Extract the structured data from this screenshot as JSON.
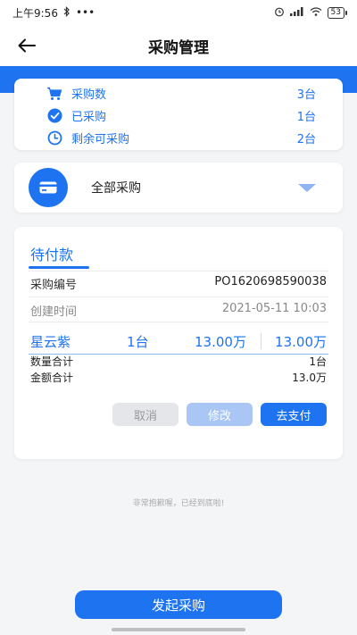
{
  "status_bar": {
    "time": "上午9:56",
    "battery": "53",
    "dots": "•••"
  },
  "header": {
    "title": "采购管理"
  },
  "summary": {
    "items": [
      {
        "label": "采购数",
        "value": "3台",
        "icon": "cart-icon"
      },
      {
        "label": "已采购",
        "value": "1台",
        "icon": "check-circle-icon"
      },
      {
        "label": "剩余可采购",
        "value": "2台",
        "icon": "clock-icon"
      }
    ]
  },
  "filter": {
    "selected": "全部采购",
    "icon": "card-icon"
  },
  "order": {
    "status": "待付款",
    "number_label": "采购编号",
    "number_value": "PO1620698590038",
    "created_label": "创建时间",
    "created_value": "2021-05-11 10:03",
    "product": {
      "name": "星云紫",
      "qty": "1台",
      "price": "13.00万",
      "total": "13.00万"
    },
    "qty_total_label": "数量合计",
    "qty_total_value": "1台",
    "amount_total_label": "金额合计",
    "amount_total_value": "13.0万",
    "buttons": {
      "cancel": "取消",
      "edit": "修改",
      "pay": "去支付"
    }
  },
  "list_end_text": "非常抱歉喔，已经到底啦!",
  "launch_button": "发起采购",
  "colors": {
    "accent": "#1e73f0",
    "accent_light": "#a9c6f5",
    "disabled": "#e4e6ea"
  }
}
